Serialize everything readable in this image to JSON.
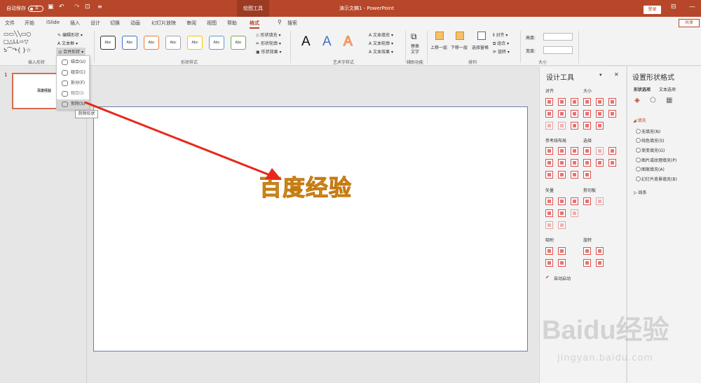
{
  "titlebar": {
    "autosave": "自动保存",
    "toggle": "关",
    "contextual_tab": "绘图工具",
    "doc_title": "演示文稿1 - PowerPoint",
    "login": "登录"
  },
  "tabs": [
    "文件",
    "开始",
    "iSlide",
    "插入",
    "设计",
    "切换",
    "动画",
    "幻灯片放映",
    "审阅",
    "视图",
    "帮助",
    "格式"
  ],
  "search": "搜索",
  "share": "共享",
  "ribbon": {
    "insert_shapes": {
      "edit_shape": "编辑形状",
      "textbox": "文本框",
      "merge_shapes": "合并形状",
      "label": "插入形状"
    },
    "shape_styles": {
      "style_text": "Abc",
      "fill": "形状填充",
      "outline": "形状轮廓",
      "effect": "形状效果",
      "label": "形状样式"
    },
    "wordart": {
      "letter": "A",
      "text_fill": "文本填充",
      "text_outline": "文本轮廓",
      "text_effect": "文本效果",
      "label": "艺术字样式"
    },
    "accessibility": {
      "alt": "替换",
      "alt2": "文字",
      "label": "辅助功能"
    },
    "arrange": {
      "forward": "上移一层",
      "backward": "下移一层",
      "selection": "选择窗格",
      "align": "对齐",
      "group": "组合",
      "rotate": "旋转",
      "label": "排列"
    },
    "size": {
      "height": "高度:",
      "width": "宽度:",
      "label": "大小"
    }
  },
  "slide_number": "1",
  "thumb_title": "百度经验",
  "slide_title": "百度经验",
  "dropdown": {
    "items": [
      "结合(U)",
      "组合(C)",
      "拆分(F)",
      "相交(I)",
      "剪除(S)"
    ],
    "tooltip": "剪除形状"
  },
  "design_panel": {
    "title": "设计工具",
    "align": "对齐",
    "size": "大小",
    "guides": "参考线布局",
    "select": "选择",
    "vector": "矢量",
    "clipboard": "剪切板",
    "snap": "吸附",
    "rotate": "旋转",
    "auto_start": "自动启动"
  },
  "format_panel": {
    "title": "设置形状格式",
    "tab_shape": "形状选项",
    "tab_text": "文本选项",
    "fill": "填充",
    "options": [
      "无填充(N)",
      "纯色填充(S)",
      "渐变填充(G)",
      "图片或纹理填充(P)",
      "图案填充(A)",
      "幻灯片背景填充(B)"
    ],
    "line": "线条"
  },
  "watermark": {
    "big": "Baidu经验",
    "small": "jingyan.baidu.com"
  },
  "colors": {
    "accent": "#b7472a",
    "title_fill": "#f0c020",
    "arrow": "#e8281c"
  }
}
